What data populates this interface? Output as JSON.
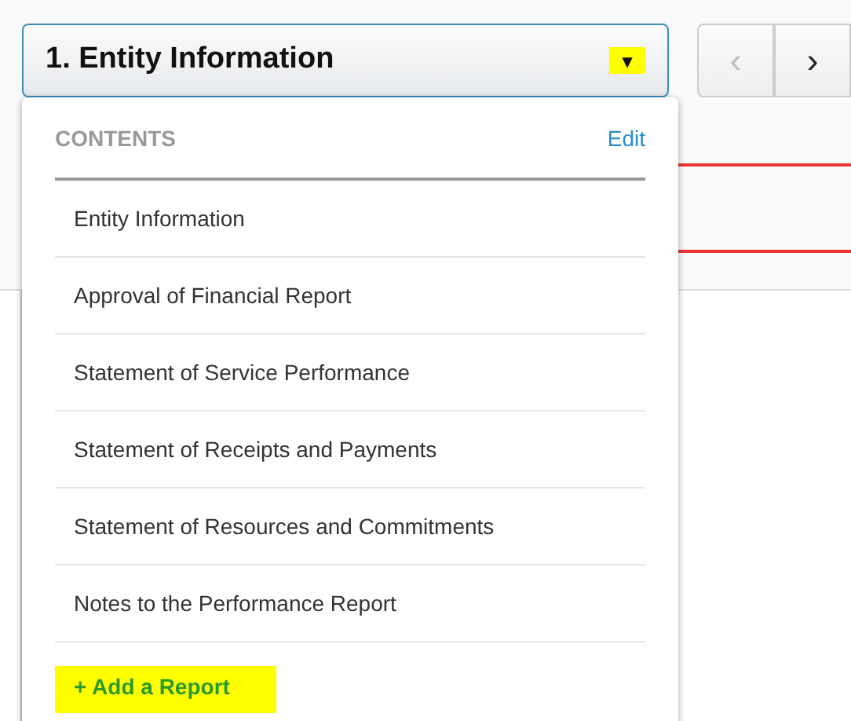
{
  "section_select": {
    "label": "1. Entity Information",
    "caret": "▾",
    "expanded": true
  },
  "pager": {
    "previous": "‹",
    "next": "›",
    "previous_disabled": true
  },
  "contents_menu": {
    "heading": "CONTENTS",
    "edit": "Edit",
    "items": [
      {
        "label": "Entity Information"
      },
      {
        "label": "Approval of Financial Report"
      },
      {
        "label": "Statement of Service Performance"
      },
      {
        "label": "Statement of Receipts and Payments"
      },
      {
        "label": "Statement of Resources and Commitments"
      },
      {
        "label": "Notes to the Performance Report"
      }
    ],
    "add_link": "+ Add a Report"
  }
}
